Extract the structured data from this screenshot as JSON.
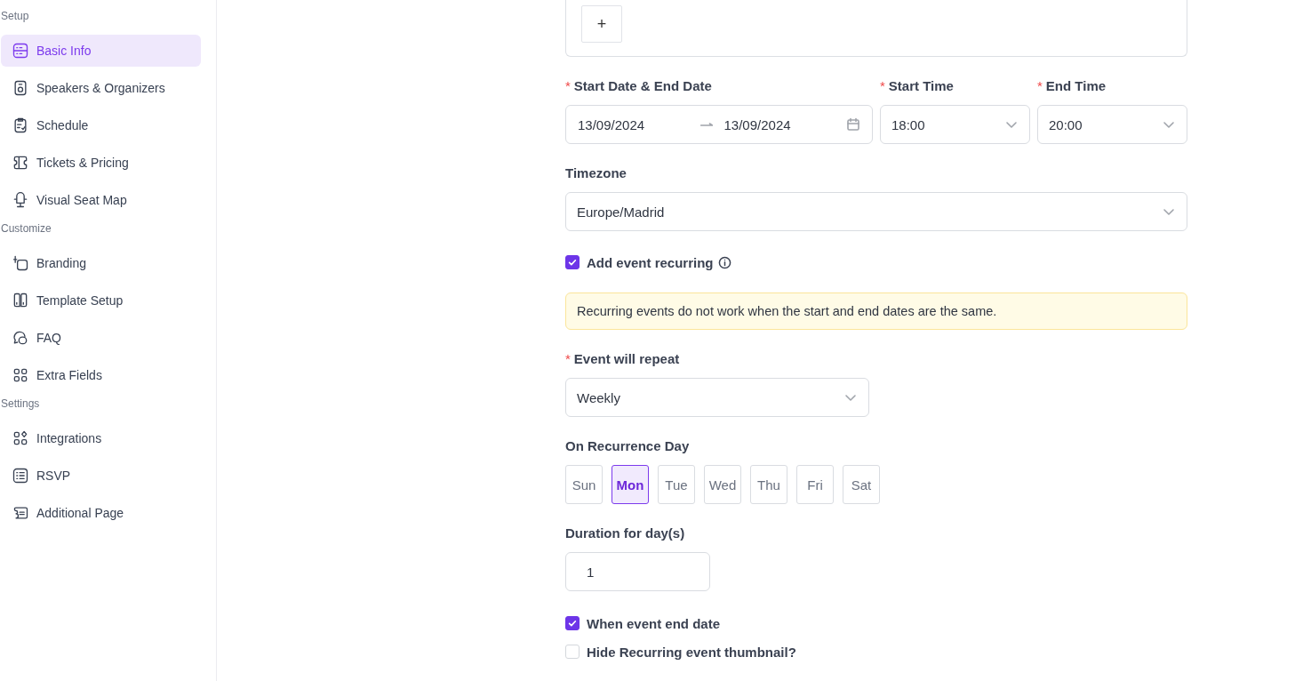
{
  "sidebar": {
    "sections": [
      {
        "title": "Setup",
        "items": [
          {
            "label": "Basic Info",
            "selected": true
          },
          {
            "label": "Speakers & Organizers",
            "selected": false
          },
          {
            "label": "Schedule",
            "selected": false
          },
          {
            "label": "Tickets & Pricing",
            "selected": false
          },
          {
            "label": "Visual Seat Map",
            "selected": false
          }
        ]
      },
      {
        "title": "Customize",
        "items": [
          {
            "label": "Branding",
            "selected": false
          },
          {
            "label": "Template Setup",
            "selected": false
          },
          {
            "label": "FAQ",
            "selected": false
          },
          {
            "label": "Extra Fields",
            "selected": false
          }
        ]
      },
      {
        "title": "Settings",
        "items": [
          {
            "label": "Integrations",
            "selected": false
          },
          {
            "label": "RSVP",
            "selected": false
          },
          {
            "label": "Additional Page",
            "selected": false
          }
        ]
      }
    ]
  },
  "form": {
    "add_button": "+",
    "required_mark": "*",
    "date_label": "Start Date & End Date",
    "start_date": "13/09/2024",
    "end_date": "13/09/2024",
    "start_time_label": "Start Time",
    "start_time": "18:00",
    "end_time_label": "End Time",
    "end_time": "20:00",
    "timezone_label": "Timezone",
    "timezone": "Europe/Madrid",
    "recurring": {
      "label": "Add event recurring",
      "checked": true
    },
    "alert": "Recurring events do not work when the start and end dates are the same.",
    "repeat_label": "Event will repeat",
    "repeat": "Weekly",
    "days_label": "On Recurrence Day",
    "days": [
      {
        "label": "Sun",
        "selected": false
      },
      {
        "label": "Mon",
        "selected": true
      },
      {
        "label": "Tue",
        "selected": false
      },
      {
        "label": "Wed",
        "selected": false
      },
      {
        "label": "Thu",
        "selected": false
      },
      {
        "label": "Fri",
        "selected": false
      },
      {
        "label": "Sat",
        "selected": false
      }
    ],
    "duration_label": "Duration for day(s)",
    "duration": "1",
    "options": [
      {
        "label": "When event end date",
        "checked": true
      },
      {
        "label": "Hide Recurring event thumbnail?",
        "checked": false
      }
    ]
  }
}
